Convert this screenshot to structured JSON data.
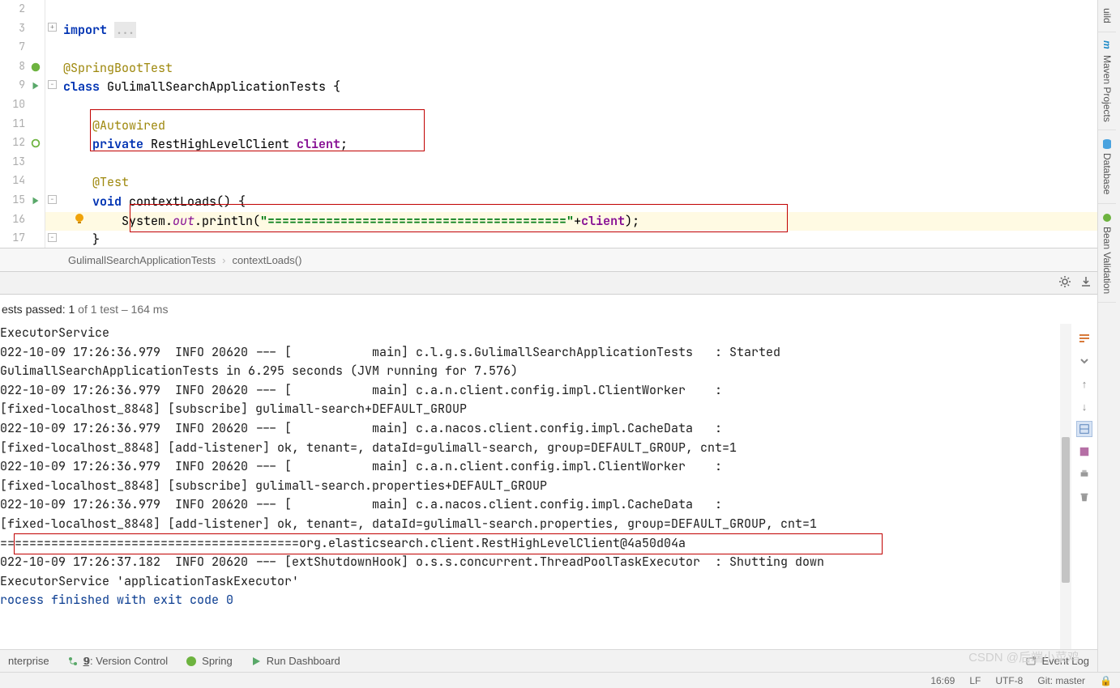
{
  "gutter": [
    {
      "n": "2",
      "icon": ""
    },
    {
      "n": "3",
      "icon": "plus"
    },
    {
      "n": "7",
      "icon": ""
    },
    {
      "n": "8",
      "icon": "spring"
    },
    {
      "n": "9",
      "icon": "run"
    },
    {
      "n": "10",
      "icon": ""
    },
    {
      "n": "11",
      "icon": ""
    },
    {
      "n": "12",
      "icon": "bean"
    },
    {
      "n": "13",
      "icon": ""
    },
    {
      "n": "14",
      "icon": ""
    },
    {
      "n": "15",
      "icon": "run"
    },
    {
      "n": "16",
      "icon": "bulb"
    },
    {
      "n": "17",
      "icon": ""
    }
  ],
  "code": {
    "l2": "",
    "l3_import": "import ",
    "l3_dots": "...",
    "l7": "",
    "l8": "@SpringBootTest",
    "l9_kw": "class ",
    "l9_name": "GulimallSearchApplicationTests ",
    "l9_brace": "{",
    "l10": "",
    "l11": "    @Autowired",
    "l12_kw": "    private ",
    "l12_typ": "RestHighLevelClient ",
    "l12_fld": "client",
    "l12_semi": ";",
    "l13": "",
    "l14": "    @Test",
    "l15_kw": "    void ",
    "l15_name": "contextLoads",
    "l15_paren": "() {",
    "l16_pre": "        System.",
    "l16_out": "out",
    "l16_mid": ".println(",
    "l16_str": "\"=========================================\"",
    "l16_plus": "+",
    "l16_cli": "client",
    "l16_end": ");",
    "l17": "    }"
  },
  "breadcrumb": {
    "a": "GulimallSearchApplicationTests",
    "b": "contextLoads()"
  },
  "test_summary": {
    "prefix": "ests passed: ",
    "count": "1",
    "of": " of 1 test – 164 ms"
  },
  "console_lines": [
    "ExecutorService",
    "022-10-09 17:26:36.979  INFO 20620 --- [           main] c.l.g.s.GulimallSearchApplicationTests   : Started ",
    "GulimallSearchApplicationTests in 6.295 seconds (JVM running for 7.576)",
    "022-10-09 17:26:36.979  INFO 20620 --- [           main] c.a.n.client.config.impl.ClientWorker    : ",
    "[fixed-localhost_8848] [subscribe] gulimall-search+DEFAULT_GROUP",
    "022-10-09 17:26:36.979  INFO 20620 --- [           main] c.a.nacos.client.config.impl.CacheData   : ",
    "[fixed-localhost_8848] [add-listener] ok, tenant=, dataId=gulimall-search, group=DEFAULT_GROUP, cnt=1",
    "022-10-09 17:26:36.979  INFO 20620 --- [           main] c.a.n.client.config.impl.ClientWorker    : ",
    "[fixed-localhost_8848] [subscribe] gulimall-search.properties+DEFAULT_GROUP",
    "022-10-09 17:26:36.979  INFO 20620 --- [           main] c.a.nacos.client.config.impl.CacheData   : ",
    "[fixed-localhost_8848] [add-listener] ok, tenant=, dataId=gulimall-search.properties, group=DEFAULT_GROUP, cnt=1",
    "=========================================org.elasticsearch.client.RestHighLevelClient@4a50d04a",
    "022-10-09 17:26:37.182  INFO 20620 --- [extShutdownHook] o.s.s.concurrent.ThreadPoolTaskExecutor  : Shutting down ",
    "ExecutorService 'applicationTaskExecutor'",
    "",
    "rocess finished with exit code 0"
  ],
  "right_tabs": [
    "uild",
    "Maven Projects",
    "Database",
    "Bean Validation"
  ],
  "bottom": {
    "terminal": "nterprise",
    "vcs": "9: Version Control",
    "spring": "Spring",
    "rundash": "Run Dashboard",
    "event": "Event Log"
  },
  "status": {
    "pos": "16:69",
    "le": "LF",
    "enc": "UTF-8",
    "git": "Git: master",
    "lock": "🔒"
  },
  "watermark": "CSDN @后端小菜鸡"
}
